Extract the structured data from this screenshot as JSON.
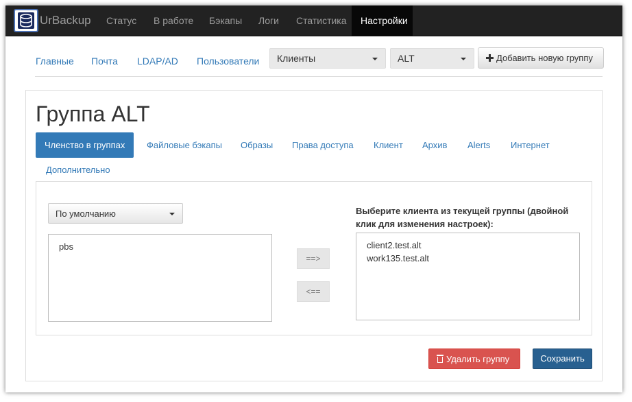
{
  "navbar": {
    "brand": "UrBackup",
    "items": [
      {
        "label": "Статус"
      },
      {
        "label": "В работе"
      },
      {
        "label": "Бэкапы"
      },
      {
        "label": "Логи"
      },
      {
        "label": "Статистика"
      },
      {
        "label": "Настройки",
        "active": true
      }
    ]
  },
  "settings_tabs": [
    {
      "label": "Главные"
    },
    {
      "label": "Почта"
    },
    {
      "label": "LDAP/AD"
    },
    {
      "label": "Пользователи"
    }
  ],
  "selects": {
    "type": {
      "value": "Клиенты"
    },
    "group": {
      "value": "ALT"
    }
  },
  "add_group_button": "Добавить новую группу",
  "page_title": "Группа ALT",
  "group_tabs": [
    {
      "label": "Членство в группах",
      "active": true
    },
    {
      "label": "Файловые бэкапы"
    },
    {
      "label": "Образы"
    },
    {
      "label": "Права доступа"
    },
    {
      "label": "Клиент"
    },
    {
      "label": "Архив"
    },
    {
      "label": "Alerts"
    },
    {
      "label": "Интернет"
    },
    {
      "label": "Дополнительно"
    }
  ],
  "membership": {
    "source_select": {
      "value": "По умолчанию"
    },
    "available_clients": [
      "pbs"
    ],
    "add_button": "==>",
    "remove_button": "<==",
    "current_label": "Выберите клиента из текущей группы (двойной клик для изменения настроек):",
    "current_clients": [
      "client2.test.alt",
      "work135.test.alt"
    ]
  },
  "actions": {
    "delete_label": "Удалить группу",
    "save_label": "Сохранить"
  },
  "colors": {
    "navbar_bg": "#222222",
    "link": "#337ab7",
    "danger": "#d9534f",
    "primary": "#286090"
  }
}
